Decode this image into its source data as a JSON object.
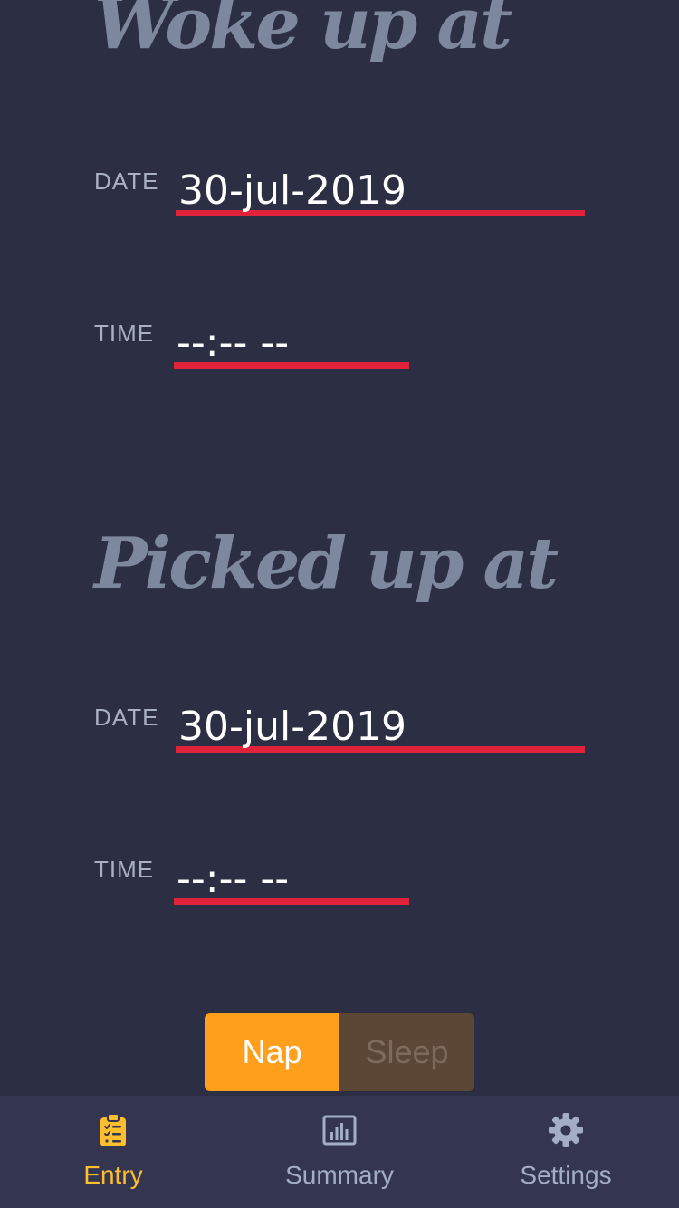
{
  "woke_section": {
    "heading": "Woke up at",
    "date_label": "DATE",
    "date_value": "30-jul-2019",
    "time_label": "TIME",
    "time_value": "--:-- --"
  },
  "picked_section": {
    "heading": "Picked up at",
    "date_label": "DATE",
    "date_value": "30-jul-2019",
    "time_label": "TIME",
    "time_value": "--:-- --"
  },
  "toggle": {
    "options": [
      "Nap",
      "Sleep"
    ],
    "selected": "Nap"
  },
  "bottom_nav": {
    "items": [
      {
        "label": "Entry",
        "icon": "clipboard-list-icon",
        "active": true
      },
      {
        "label": "Summary",
        "icon": "bar-chart-icon",
        "active": false
      },
      {
        "label": "Settings",
        "icon": "gear-icon",
        "active": false
      }
    ]
  },
  "colors": {
    "background": "#2c2e43",
    "nav_background": "#34354f",
    "heading": "#7d889f",
    "underline": "#e0233a",
    "toggle_active": "#ff9f1c",
    "toggle_inactive": "#5c4737",
    "nav_active": "#ffbe2d",
    "nav_inactive": "#a3aec5"
  }
}
